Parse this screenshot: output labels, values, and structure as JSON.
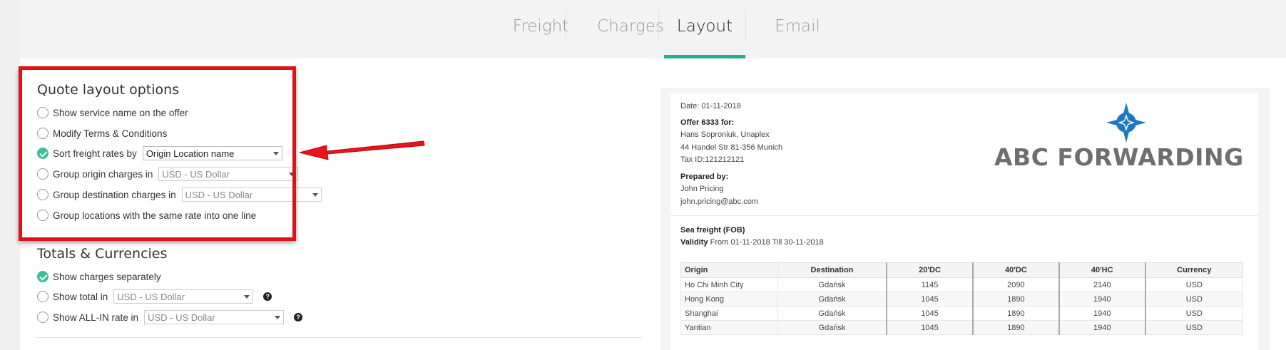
{
  "tabs": [
    {
      "label": "Freight",
      "active": false
    },
    {
      "label": "Charges",
      "active": false
    },
    {
      "label": "Layout",
      "active": true
    },
    {
      "label": "Email",
      "active": false
    }
  ],
  "quote_layout": {
    "title": "Quote layout options",
    "options": [
      {
        "label": "Show service name on the offer",
        "checked": false
      },
      {
        "label": "Modify Terms & Conditions",
        "checked": false
      },
      {
        "label": "Sort freight rates by",
        "checked": true,
        "select": "Origin Location name"
      },
      {
        "label": "Group origin charges in",
        "checked": false,
        "select": "USD - US Dollar"
      },
      {
        "label": "Group destination charges in",
        "checked": false,
        "select": "USD - US Dollar"
      },
      {
        "label": "Group locations with the same rate into one line",
        "checked": false
      }
    ]
  },
  "totals": {
    "title": "Totals & Currencies",
    "options": [
      {
        "label": "Show charges separately",
        "checked": true
      },
      {
        "label": "Show total in",
        "checked": false,
        "select": "USD - US Dollar",
        "help": "?"
      },
      {
        "label": "Show ALL-IN rate in",
        "checked": false,
        "select": "USD - US Dollar",
        "help": "?"
      }
    ]
  },
  "colors": {
    "accent": "#1fae8c",
    "highlight": "#d9151a",
    "check": "#3dbf9b"
  },
  "preview": {
    "date": "Date: 01-11-2018",
    "offer_heading": "Offer 6333 for:",
    "client_name": "Hans Soproniuk, Unaplex",
    "client_address": "44 Handel Str 81-356 Munich",
    "tax_id": "Tax ID:121212121",
    "prepared_heading": "Prepared by:",
    "prepared_name": "John Pricing",
    "prepared_email": "john.pricing@abc.com",
    "logo_text": "ABC FORWARDING",
    "freight_heading": "Sea freight (FOB)",
    "validity_label": "Validity",
    "validity_text": "From 01-11-2018 Till 30-11-2018",
    "table": {
      "headers": [
        "Origin",
        "Destination",
        "20'DC",
        "40'DC",
        "40'HC",
        "Currency"
      ],
      "rows": [
        [
          "Ho Chi Minh City",
          "Gdańsk",
          "1145",
          "2090",
          "2140",
          "USD"
        ],
        [
          "Hong Kong",
          "Gdańsk",
          "1045",
          "1890",
          "1940",
          "USD"
        ],
        [
          "Shanghai",
          "Gdańsk",
          "1045",
          "1890",
          "1940",
          "USD"
        ],
        [
          "Yantian",
          "Gdańsk",
          "1045",
          "1890",
          "1940",
          "USD"
        ]
      ]
    }
  }
}
